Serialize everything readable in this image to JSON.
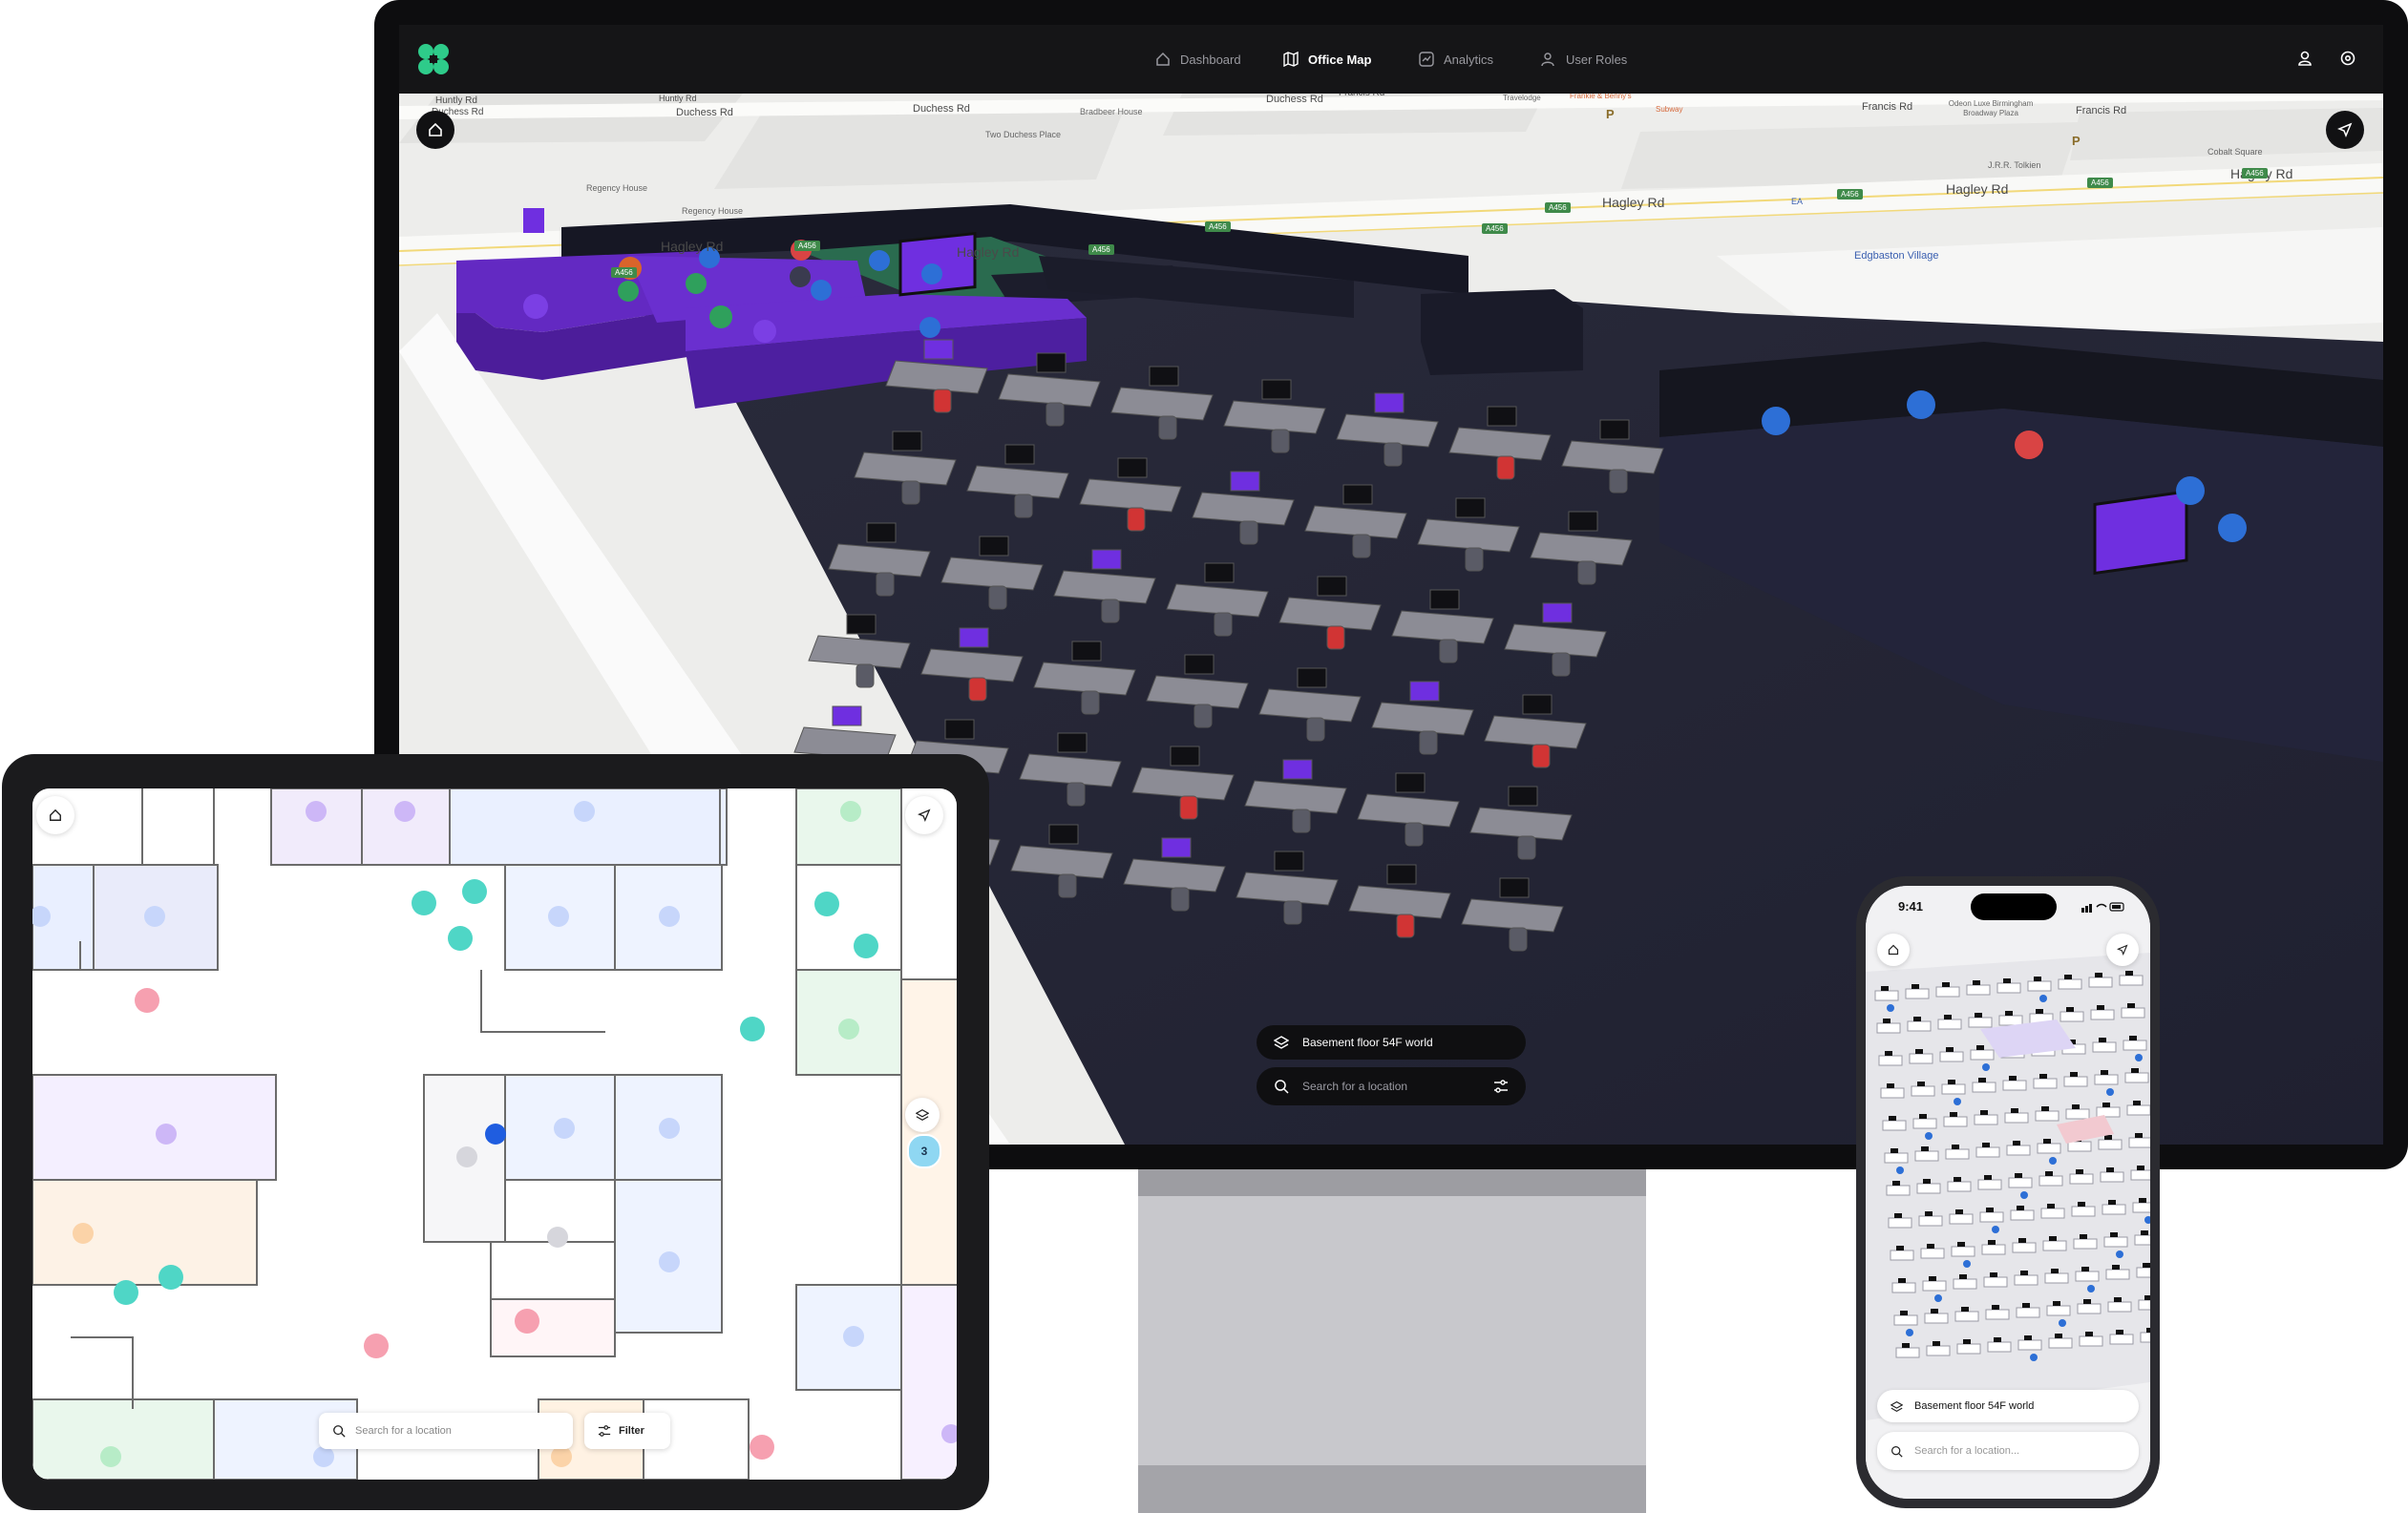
{
  "desktop": {
    "nav": {
      "items": [
        {
          "label": "Dashboard",
          "icon": "home-icon"
        },
        {
          "label": "Office Map",
          "icon": "map-icon",
          "active": true
        },
        {
          "label": "Analytics",
          "icon": "analytics-icon"
        },
        {
          "label": "User Roles",
          "icon": "user-roles-icon"
        }
      ],
      "right_icons": [
        "user-icon",
        "settings-icon"
      ]
    },
    "map_labels": {
      "roads": [
        "Huntly Rd",
        "Huntly Rd",
        "Duchess Rd",
        "Duchess Rd",
        "Duchess Rd",
        "Duchess Rd",
        "Francis Rd",
        "Francis Rd",
        "Francis Rd",
        "Hagley Rd",
        "Hagley Rd",
        "Hagley Rd",
        "Hagley Rd",
        "Hagley Rd"
      ],
      "places": [
        "Bradbeer House",
        "Two Duchess Place",
        "Regency House",
        "Regency House",
        "Travelodge",
        "Frankie & Benny's",
        "Subway",
        "Odeon Luxe Birmingham Broadway Plaza",
        "J.R.R. Tolkien",
        "Cobalt Square",
        "Edgbaston Village",
        "EA"
      ],
      "shield": "A456",
      "parking": "P"
    },
    "floor_selector": "Basement floor 54F world",
    "search": {
      "placeholder": "Search for a location"
    }
  },
  "tablet": {
    "search": {
      "placeholder": "Search for a location"
    },
    "filter_label": "Filter",
    "floor_count": "3"
  },
  "phone": {
    "time": "9:41",
    "floor_selector": "Basement floor 54F world",
    "search": {
      "placeholder": "Search for a location..."
    }
  },
  "colors": {
    "brand_green": "#2ecb8a",
    "purple": "#7b3fe4",
    "purple_room": "#5b23b8",
    "dark_floor": "#262736",
    "wall": "#1f2030",
    "blue_icon": "#2d6fd6",
    "red_icon": "#d94444",
    "teal_icon": "#4fd6c6",
    "chair_red": "#d13434"
  }
}
